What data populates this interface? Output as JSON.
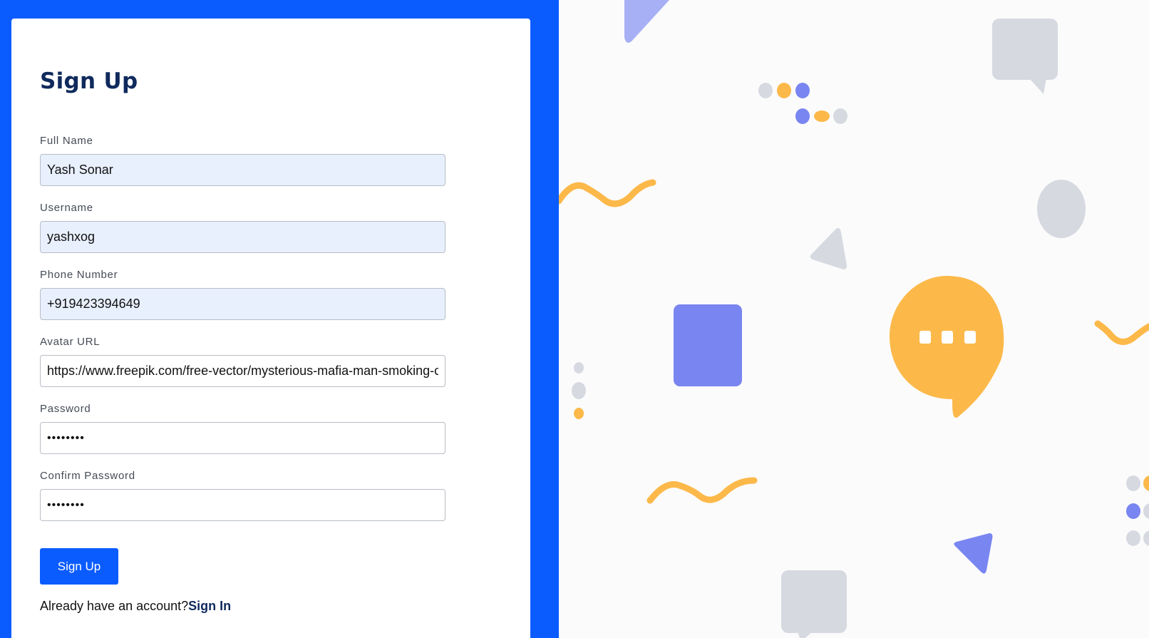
{
  "form": {
    "title": "Sign Up",
    "fields": [
      {
        "label": "Full Name",
        "value": "Yash Sonar",
        "type": "text"
      },
      {
        "label": "Username",
        "value": "yashxog",
        "type": "text"
      },
      {
        "label": "Phone Number",
        "value": "+919423394649",
        "type": "text"
      },
      {
        "label": "Avatar URL",
        "value": "https://www.freepik.com/free-vector/mysterious-mafia-man-smoking-cig",
        "type": "text"
      },
      {
        "label": "Password",
        "value": "••••••••",
        "type": "password"
      },
      {
        "label": "Confirm Password",
        "value": "••••••••",
        "type": "password"
      }
    ],
    "submit_label": "Sign Up",
    "signin_prompt": "Already have an account?",
    "signin_link": "Sign In"
  },
  "colors": {
    "brand_blue": "#0b5cff",
    "title_navy": "#0f2a5c",
    "autofill_bg": "#e8f0fe",
    "illustration_yellow": "#fcb94a",
    "illustration_purple": "#7985f0",
    "illustration_gray": "#d6d9e0",
    "illustration_lavender": "#a7b0f5"
  },
  "illustration": {
    "icons": [
      "chat-bubble-icon",
      "ellipsis-icon",
      "squiggle-icon",
      "triangle-icon",
      "rounded-square-icon",
      "dot-cluster-icon",
      "circle-icon"
    ]
  }
}
